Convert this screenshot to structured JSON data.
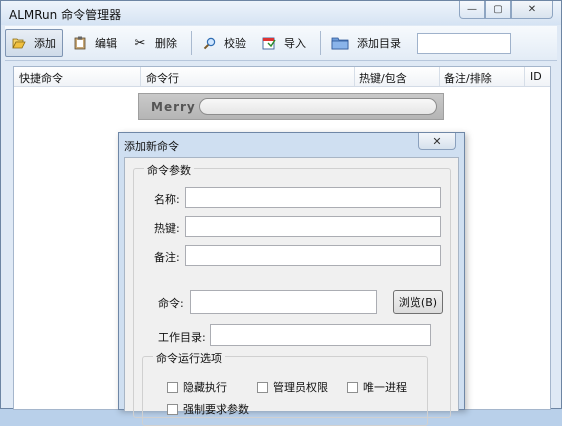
{
  "window": {
    "title": "ALMRun 命令管理器",
    "controls": [
      "—",
      "▢",
      "✕"
    ]
  },
  "toolbar": {
    "add": "添加",
    "edit": "编辑",
    "delete": "删除",
    "verify": "校验",
    "import": "导入",
    "add_dir": "添加目录",
    "search_value": ""
  },
  "list": {
    "columns": [
      "快捷命令",
      "命令行",
      "热键/包含",
      "备注/排除",
      "ID"
    ]
  },
  "merry": {
    "label": "Merry",
    "input_value": ""
  },
  "dialog": {
    "title": "添加新命令",
    "close": "✕",
    "group_title": "命令参数",
    "name_label": "名称:",
    "hotkey_label": "热键:",
    "note_label": "备注:",
    "command_label": "命令:",
    "browse": "浏览(B)",
    "workdir_label": "工作目录:",
    "options_title": "命令运行选项",
    "options": [
      "隐藏执行",
      "管理员权限",
      "唯一进程",
      "强制要求参数"
    ],
    "values": {
      "name": "",
      "hotkey": "",
      "note": "",
      "command": "",
      "workdir": ""
    }
  }
}
